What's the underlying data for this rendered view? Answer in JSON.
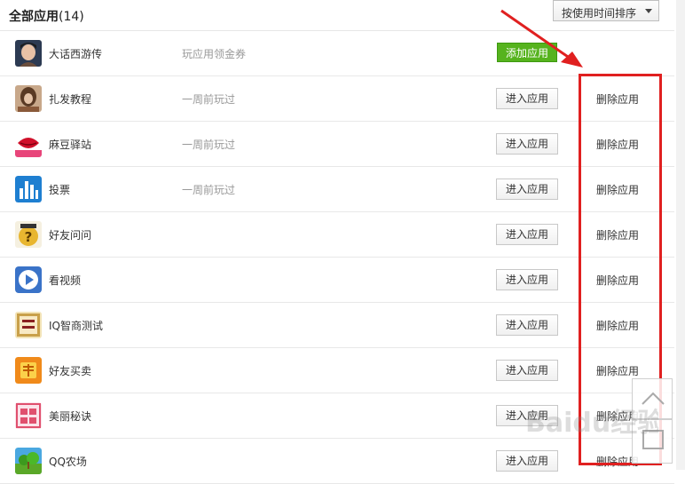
{
  "header": {
    "title": "全部应用",
    "count": "(14)"
  },
  "sort": {
    "label": "按使用时间排序",
    "icon": "chevron-down-icon"
  },
  "apps": [
    {
      "name": "大话西游传",
      "meta": "玩应用领金券",
      "action": "添加应用",
      "delete": ""
    },
    {
      "name": "扎发教程",
      "meta": "一周前玩过",
      "action": "进入应用",
      "delete": "删除应用"
    },
    {
      "name": "麻豆驿站",
      "meta": "一周前玩过",
      "action": "进入应用",
      "delete": "删除应用"
    },
    {
      "name": "投票",
      "meta": "一周前玩过",
      "action": "进入应用",
      "delete": "删除应用"
    },
    {
      "name": "好友问问",
      "meta": "",
      "action": "进入应用",
      "delete": "删除应用"
    },
    {
      "name": "看视频",
      "meta": "",
      "action": "进入应用",
      "delete": "删除应用"
    },
    {
      "name": "IQ智商测试",
      "meta": "",
      "action": "进入应用",
      "delete": "删除应用"
    },
    {
      "name": "好友买卖",
      "meta": "",
      "action": "进入应用",
      "delete": "删除应用"
    },
    {
      "name": "美丽秘诀",
      "meta": "",
      "action": "进入应用",
      "delete": "删除应用"
    },
    {
      "name": "QQ农场",
      "meta": "",
      "action": "进入应用",
      "delete": "删除应用"
    }
  ],
  "icons": {
    "app0": "portrait-icon",
    "app1": "hair-icon",
    "app2": "lips-icon",
    "app3": "bar-chart-icon",
    "app4": "question-icon",
    "app5": "play-icon",
    "app6": "iq-badge-icon",
    "app7": "money-icon",
    "app8": "beauty-icon",
    "app9": "farm-icon"
  },
  "annotation": {
    "color": "#e02020"
  },
  "watermark": {
    "text": "Baidu经验"
  }
}
